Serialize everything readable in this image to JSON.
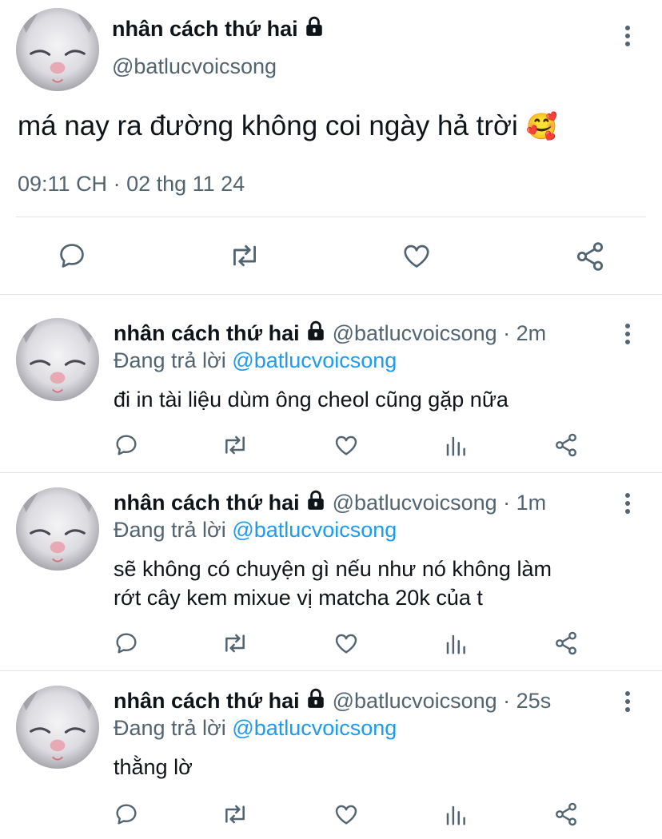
{
  "main_tweet": {
    "display_name": "nhân cách thứ hai",
    "handle": "@batlucvoicsong",
    "text": "má nay ra đường không coi ngày hả trời",
    "emoji": "🥰",
    "time": "09:11 CH",
    "date": "02 thg 11 24",
    "locked_icon": "lock-icon",
    "actions": [
      "reply-icon",
      "retweet-icon",
      "like-icon",
      "share-icon"
    ]
  },
  "replies": [
    {
      "display_name": "nhân cách thứ hai",
      "handle": "@batlucvoicsong",
      "age": "2m",
      "replying_prefix": "Đang trả lời",
      "replying_to": "@batlucvoicsong",
      "lines": [
        "đi in tài liệu dùm ông cheol cũng gặp nữa"
      ]
    },
    {
      "display_name": "nhân cách thứ hai",
      "handle": "@batlucvoicsong",
      "age": "1m",
      "replying_prefix": "Đang trả lời",
      "replying_to": "@batlucvoicsong",
      "lines": [
        "sẽ không có chuyện gì nếu như nó không làm",
        "rớt cây kem mixue vị matcha 20k của t"
      ]
    },
    {
      "display_name": "nhân cách thứ hai",
      "handle": "@batlucvoicsong",
      "age": "25s",
      "replying_prefix": "Đang trả lời",
      "replying_to": "@batlucvoicsong",
      "lines": [
        "thằng lờ"
      ]
    }
  ],
  "colors": {
    "text": "#0f1419",
    "secondary": "#536471",
    "link": "#1d9bf0",
    "divider": "#e1e6ea"
  },
  "separator": " · "
}
